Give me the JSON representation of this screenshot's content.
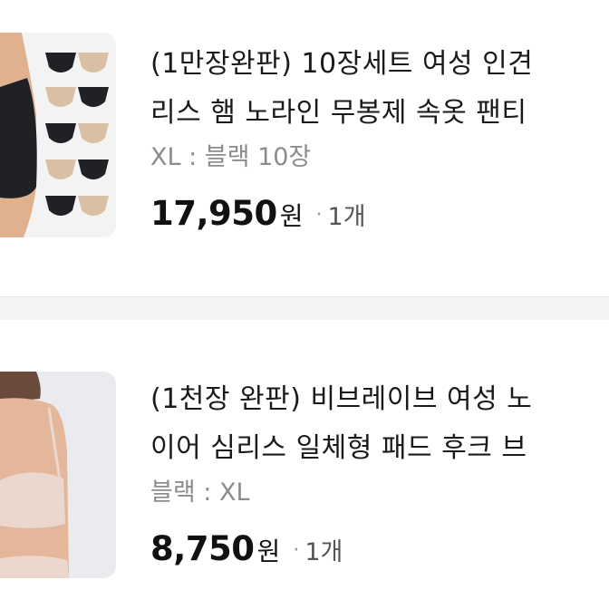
{
  "items": [
    {
      "title_line1": "(1만장완판) 10장세트 여성 인견",
      "title_line2": "리스 햄 노라인 무봉제 속옷 팬티",
      "option": "XL : 블랙 10장",
      "price": "17,950",
      "currency": "원",
      "separator": "·",
      "quantity": "1개"
    },
    {
      "title_line1": "(1천장 완판) 비브레이브 여성 노",
      "title_line2": "이어 심리스 일체형 패드 후크 브",
      "option": "블랙 : XL",
      "price": "8,750",
      "currency": "원",
      "separator": "·",
      "quantity": "1개"
    }
  ],
  "colors": {
    "title": "#1a1a1a",
    "option": "#8c8c8c",
    "price": "#111111",
    "divider": "#f4f4f4",
    "panty_black": "#1f2125",
    "panty_beige": "#d9bfa3",
    "skin": "#e4b79a",
    "bra_pink": "#ecd7cf"
  }
}
